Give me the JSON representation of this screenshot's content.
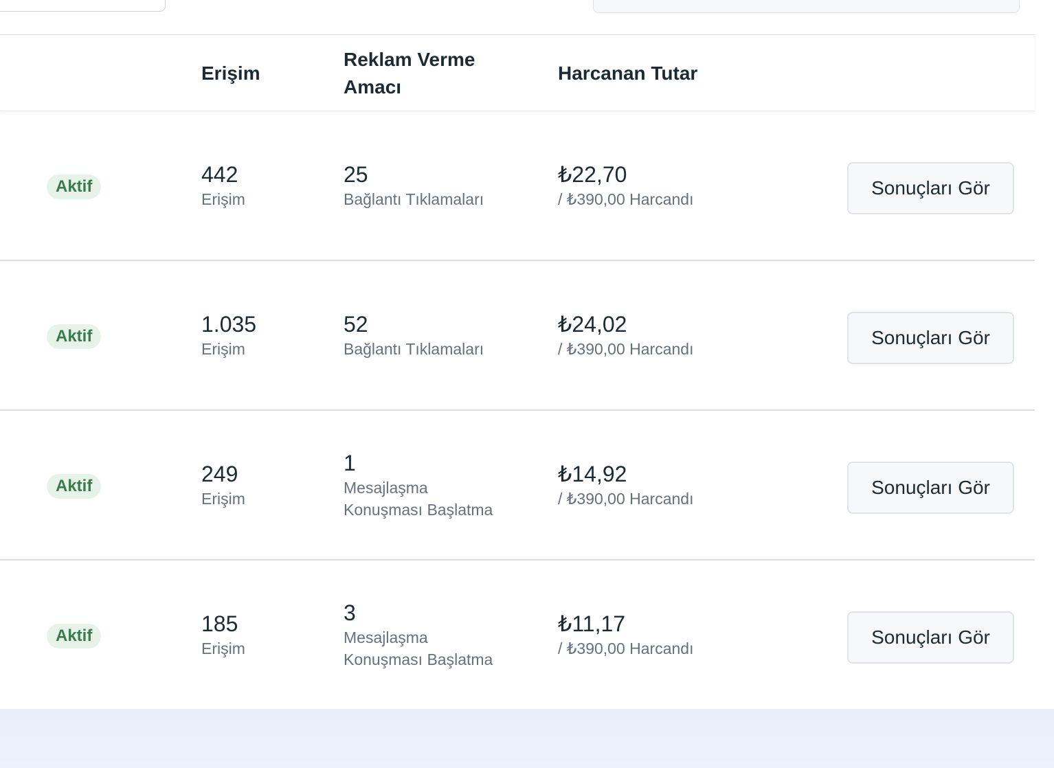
{
  "header": {
    "reach": "Erişim",
    "objective": "Reklam Verme Amacı",
    "spent": "Harcanan Tutar"
  },
  "rows": [
    {
      "status": "Aktif",
      "reach_value": "442",
      "reach_label": "Erişim",
      "objective_value": "25",
      "objective_label": "Bağlantı Tıklamaları",
      "spent_value": "₺22,70",
      "spent_label": "/ ₺390,00 Harcandı",
      "button": "Sonuçları Gör"
    },
    {
      "status": "Aktif",
      "reach_value": "1.035",
      "reach_label": "Erişim",
      "objective_value": "52",
      "objective_label": "Bağlantı Tıklamaları",
      "spent_value": "₺24,02",
      "spent_label": "/ ₺390,00 Harcandı",
      "button": "Sonuçları Gör"
    },
    {
      "status": "Aktif",
      "reach_value": "249",
      "reach_label": "Erişim",
      "objective_value": "1",
      "objective_label": "Mesajlaşma Konuşması Başlatma",
      "spent_value": "₺14,92",
      "spent_label": "/ ₺390,00 Harcandı",
      "button": "Sonuçları Gör"
    },
    {
      "status": "Aktif",
      "reach_value": "185",
      "reach_label": "Erişim",
      "objective_value": "3",
      "objective_label": "Mesajlaşma Konuşması Başlatma",
      "spent_value": "₺11,17",
      "spent_label": "/ ₺390,00 Harcandı",
      "button": "Sonuçları Gör"
    }
  ],
  "colors": {
    "active_badge_bg": "#e7f3e8",
    "active_badge_text": "#3a7a4d",
    "button_bg": "#f7f8fa",
    "footer_bg": "#e9eefb"
  }
}
